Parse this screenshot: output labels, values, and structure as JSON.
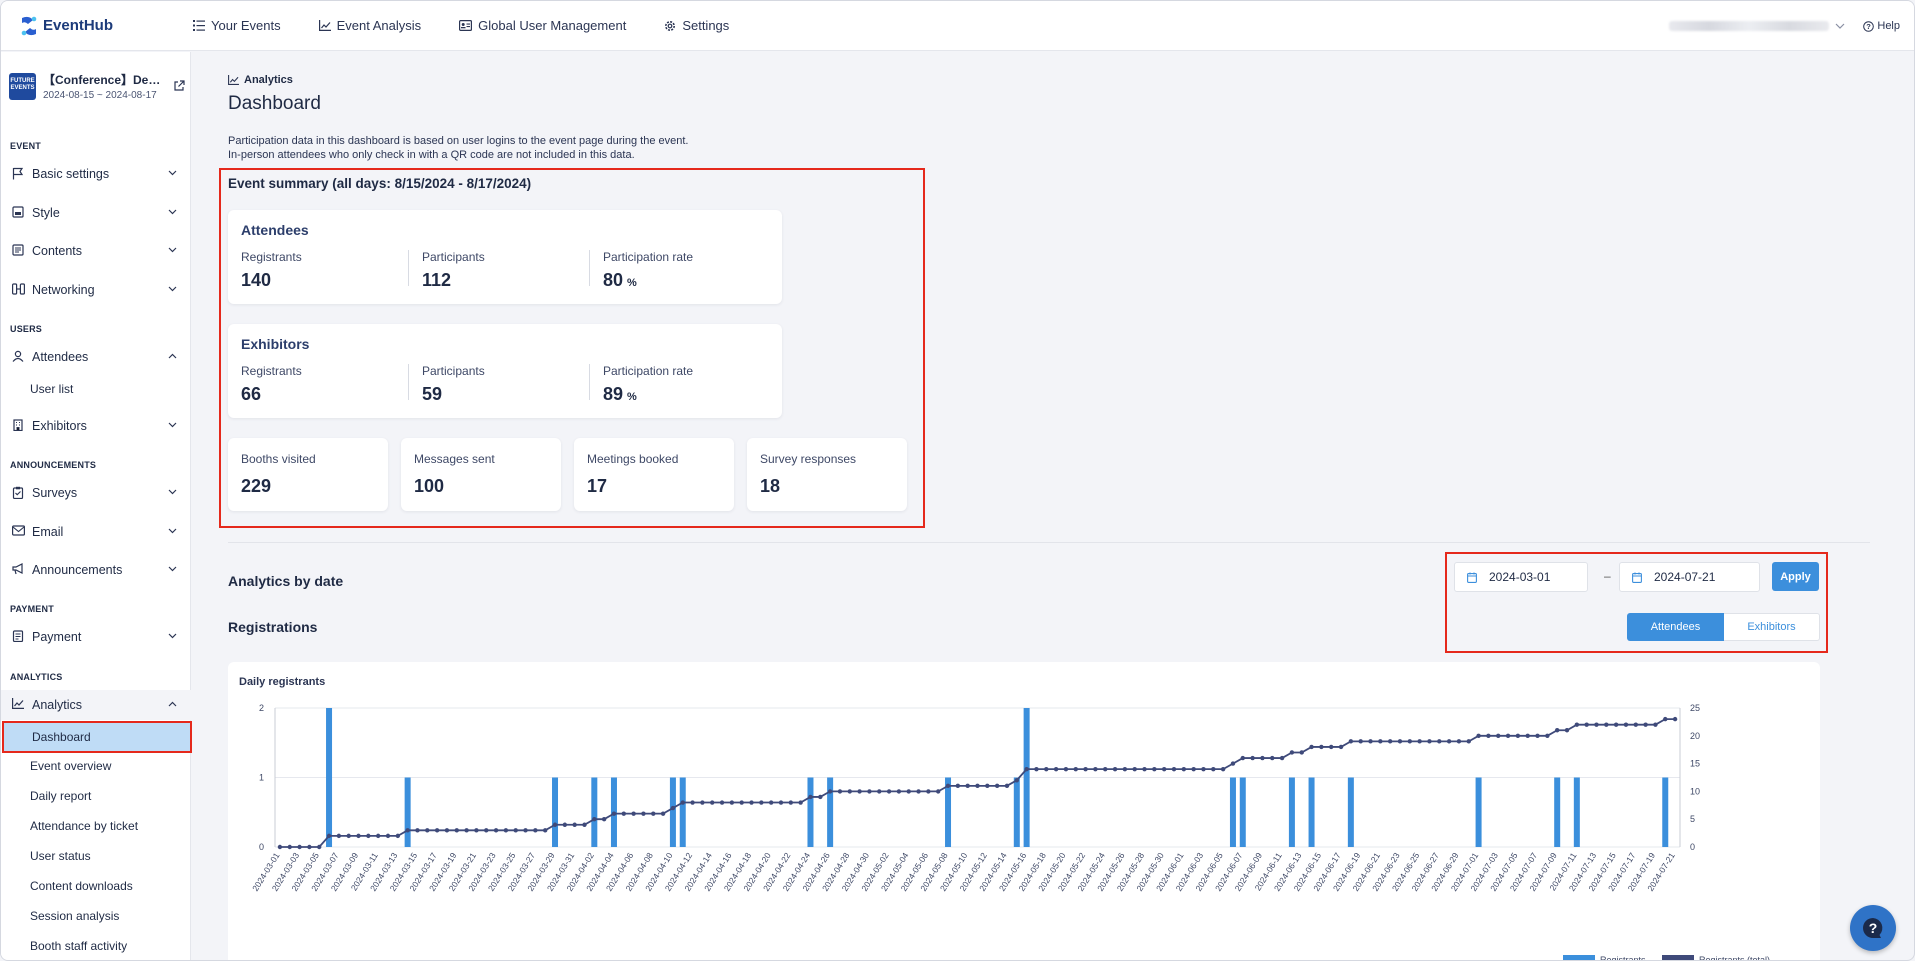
{
  "app": {
    "name": "EventHub"
  },
  "nav": {
    "items": [
      {
        "label": "Your Events",
        "icon": "list-icon"
      },
      {
        "label": "Event Analysis",
        "icon": "chart-line-icon"
      },
      {
        "label": "Global User Management",
        "icon": "id-card-icon"
      },
      {
        "label": "Settings",
        "icon": "gear-icon"
      }
    ],
    "help": "Help"
  },
  "event": {
    "name": "【Conference】De…",
    "dates": "2024-08-15 ~ 2024-08-17",
    "thumb_text": "FUTURE EVENTS"
  },
  "sidebar": {
    "section_event": "EVENT",
    "basic_settings": "Basic settings",
    "style": "Style",
    "contents": "Contents",
    "networking": "Networking",
    "section_users": "USERS",
    "attendees": "Attendees",
    "user_list": "User list",
    "exhibitors": "Exhibitors",
    "section_announcements": "ANNOUNCEMENTS",
    "surveys": "Surveys",
    "email": "Email",
    "announcements": "Announcements",
    "section_payment": "PAYMENT",
    "payment": "Payment",
    "section_analytics": "ANALYTICS",
    "analytics": "Analytics",
    "dashboard": "Dashboard",
    "event_overview": "Event overview",
    "daily_report": "Daily report",
    "attendance_by_ticket": "Attendance by ticket",
    "user_status": "User status",
    "content_downloads": "Content downloads",
    "session_analysis": "Session analysis",
    "booth_staff_activity": "Booth staff activity"
  },
  "page": {
    "breadcrumb": "Analytics",
    "title": "Dashboard",
    "desc_line1": "Participation data in this dashboard is based on user logins to the event page during the event.",
    "desc_line2": "In-person attendees who only check in with a QR code are not included in this data."
  },
  "summary": {
    "title": "Event summary (all days: 8/15/2024 - 8/17/2024)",
    "attendees": {
      "title": "Attendees",
      "registrants_label": "Registrants",
      "registrants": "140",
      "participants_label": "Participants",
      "participants": "112",
      "rate_label": "Participation rate",
      "rate": "80",
      "rate_unit": "%"
    },
    "exhibitors": {
      "title": "Exhibitors",
      "registrants_label": "Registrants",
      "registrants": "66",
      "participants_label": "Participants",
      "participants": "59",
      "rate_label": "Participation rate",
      "rate": "89",
      "rate_unit": "%"
    },
    "booths_label": "Booths visited",
    "booths": "229",
    "messages_label": "Messages sent",
    "messages": "100",
    "meetings_label": "Meetings booked",
    "meetings": "17",
    "surveys_label": "Survey responses",
    "surveys": "18"
  },
  "by_date": {
    "title": "Analytics by date",
    "registrations_title": "Registrations",
    "start_date": "2024-03-01",
    "separator": "–",
    "end_date": "2024-07-21",
    "apply": "Apply",
    "toggle_attendees": "Attendees",
    "toggle_exhibitors": "Exhibitors"
  },
  "colors": {
    "accent": "#3c8fdc",
    "highlight": "#e5291c",
    "bar": "#3b8fdc",
    "line": "#3f4a7a"
  },
  "chart_data": {
    "type": "bar",
    "title": "Daily registrants",
    "start_date": "2024-03-01",
    "end_date": "2024-07-21",
    "x_tick_step_days": 2,
    "ylim": [
      0,
      2
    ],
    "y_ticks": [
      "0",
      "1",
      "2"
    ],
    "y2lim": [
      0,
      25
    ],
    "y2_ticks": [
      "0",
      "5",
      "10",
      "15",
      "20",
      "25"
    ],
    "series": [
      {
        "name": "Registrants",
        "kind": "bar",
        "axis": "left",
        "points": [
          [
            "2024-03-06",
            2
          ],
          [
            "2024-03-14",
            1
          ],
          [
            "2024-03-29",
            1
          ],
          [
            "2024-04-02",
            1
          ],
          [
            "2024-04-04",
            1
          ],
          [
            "2024-04-10",
            1
          ],
          [
            "2024-04-11",
            1
          ],
          [
            "2024-04-24",
            1
          ],
          [
            "2024-04-26",
            1
          ],
          [
            "2024-05-08",
            1
          ],
          [
            "2024-05-15",
            1
          ],
          [
            "2024-05-16",
            2
          ],
          [
            "2024-06-06",
            1
          ],
          [
            "2024-06-07",
            1
          ],
          [
            "2024-06-12",
            1
          ],
          [
            "2024-06-14",
            1
          ],
          [
            "2024-06-18",
            1
          ],
          [
            "2024-07-01",
            1
          ],
          [
            "2024-07-09",
            1
          ],
          [
            "2024-07-11",
            1
          ],
          [
            "2024-07-20",
            1
          ]
        ]
      },
      {
        "name": "Registrants (total)",
        "kind": "line",
        "axis": "right"
      }
    ]
  }
}
